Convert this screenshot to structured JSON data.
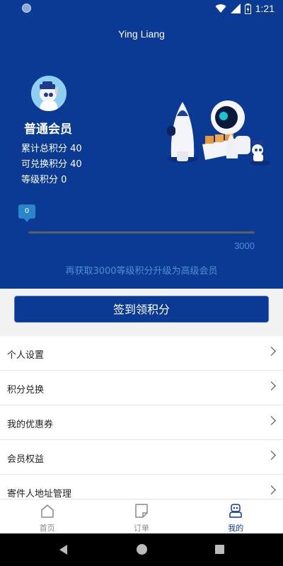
{
  "status_bar": {
    "time": "1:21"
  },
  "profile": {
    "username": "Ying Liang",
    "tier": "普通会员",
    "stats": [
      "累计总积分 40",
      "可兑换积分 40",
      "等级积分 0"
    ]
  },
  "progress": {
    "current_label": "0",
    "current_value": 0,
    "max_value": 3000,
    "max_label": "3000",
    "hint": "再获取3000等级积分升级为高级会员"
  },
  "checkin": {
    "label": "签到领积分"
  },
  "menu": {
    "items": [
      {
        "label": "个人设置"
      },
      {
        "label": "积分兑换"
      },
      {
        "label": "我的优惠券"
      },
      {
        "label": "会员权益"
      },
      {
        "label": "寄件人地址管理"
      }
    ]
  },
  "tabs": [
    {
      "label": "首页",
      "icon": "home-icon"
    },
    {
      "label": "订单",
      "icon": "order-icon"
    },
    {
      "label": "我的",
      "icon": "profile-icon",
      "active": true
    }
  ],
  "colors": {
    "primary": "#0a3a94",
    "accent": "#2a86c8",
    "hint": "#4f8fd4"
  }
}
